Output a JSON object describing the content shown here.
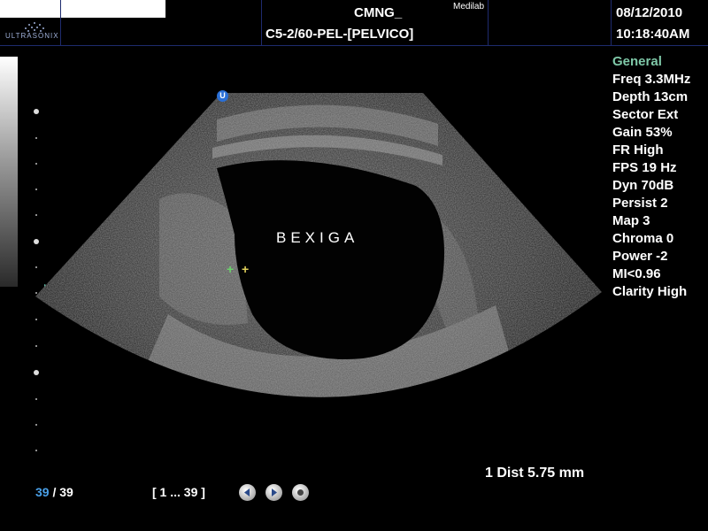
{
  "header": {
    "logo_text": "ULTRASONIX",
    "patient": "CMNG_",
    "institution": "Medilab",
    "preset": "C5-2/60-PEL-[PELVICO]",
    "date": "08/12/2010",
    "time": "10:18:40AM"
  },
  "image": {
    "label": "BEXIGA",
    "orientation_marker": "U",
    "caliper_1": "+",
    "caliper_2": "+"
  },
  "params": {
    "heading": "General",
    "items": [
      "Freq 3.3MHz",
      "Depth 13cm",
      "Sector Ext",
      "Gain 53%",
      "FR High",
      "FPS 19 Hz",
      "Dyn 70dB",
      "Persist 2",
      "Map 3",
      "Chroma 0",
      "Power -2",
      "MI<0.96",
      "Clarity High"
    ]
  },
  "measurement": "1  Dist 5.75 mm",
  "cine": {
    "current": "39",
    "total": "/ 39",
    "range": "[ 1 ... 39 ]"
  },
  "icons": {
    "prev": "step-back-icon",
    "play": "play-icon",
    "stop": "stop-icon"
  },
  "colors": {
    "param_heading": "#7fc8a8",
    "cine_current": "#4aa0e8",
    "caliper_1": "#6bd26b",
    "caliper_2": "#e0d05a",
    "orientation_marker": "#2a6fd6",
    "focus_marker": "#5fb8a4"
  }
}
